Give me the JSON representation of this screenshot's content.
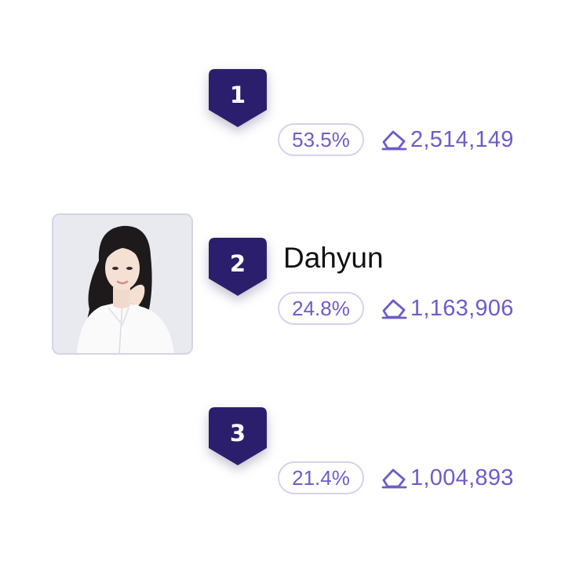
{
  "colors": {
    "badge": "#2b1f6d",
    "accent": "#6e5cc7",
    "pill_border": "#d7d1ee",
    "name_text": "#111111"
  },
  "ranking": [
    {
      "rank": "1",
      "name": "",
      "percent": "53.5%",
      "vote_icon": "eraser-icon",
      "votes": "2,514,149",
      "has_photo": false
    },
    {
      "rank": "2",
      "name": "Dahyun",
      "percent": "24.8%",
      "vote_icon": "eraser-icon",
      "votes": "1,163,906",
      "has_photo": true
    },
    {
      "rank": "3",
      "name": "",
      "percent": "21.4%",
      "vote_icon": "eraser-icon",
      "votes": "1,004,893",
      "has_photo": false
    }
  ]
}
